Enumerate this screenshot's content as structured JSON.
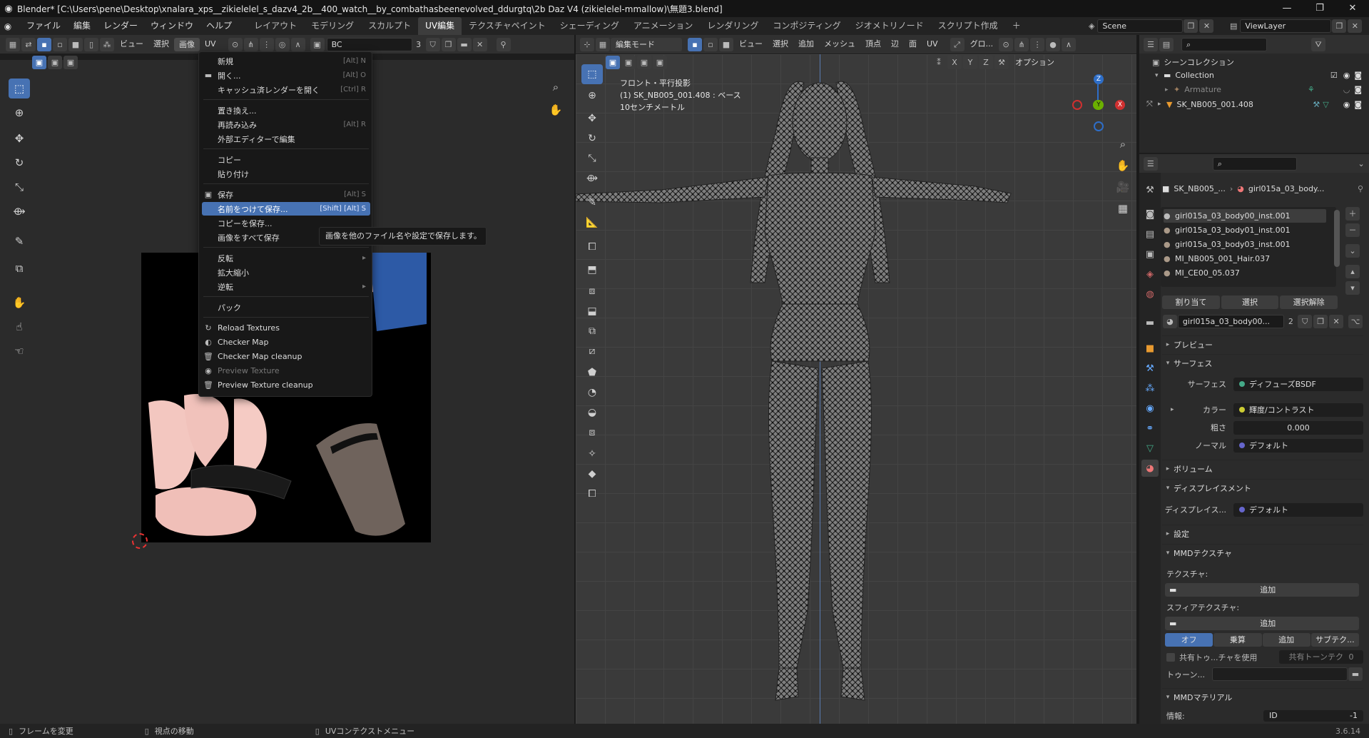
{
  "title": "Blender* [C:\\Users\\pene\\Desktop\\xnalara_xps__zikielelel_s_dazv4_2b__400_watch__by_combathasbeenevolved_ddurgtq\\2b Daz V4 (zikielelel-mmallow)\\無題3.blend]",
  "main_menu": [
    "ファイル",
    "編集",
    "レンダー",
    "ウィンドウ",
    "ヘルプ"
  ],
  "workspaces": [
    "レイアウト",
    "モデリング",
    "スカルプト",
    "UV編集",
    "テクスチャペイント",
    "シェーディング",
    "アニメーション",
    "レンダリング",
    "コンポジティング",
    "ジオメトリノード",
    "スクリプト作成"
  ],
  "active_workspace": "UV編集",
  "scene": "Scene",
  "view_layer": "ViewLayer",
  "uv_header": {
    "view": "ビュー",
    "select": "選択",
    "image": "画像",
    "uv": "UV",
    "image_name": "BC",
    "users": "3"
  },
  "image_menu": {
    "items": [
      {
        "label": "新規",
        "key": "[Alt] N"
      },
      {
        "label": "開く...",
        "key": "[Alt] O"
      },
      {
        "label": "キャッシュ済レンダーを開く",
        "key": "[Ctrl] R"
      },
      {
        "label": "置き換え...",
        "key": ""
      },
      {
        "label": "再読み込み",
        "key": "[Alt] R"
      },
      {
        "label": "外部エディターで編集",
        "key": ""
      },
      {
        "label": "コピー",
        "key": ""
      },
      {
        "label": "貼り付け",
        "key": ""
      },
      {
        "label": "保存",
        "key": "[Alt] S"
      },
      {
        "label": "名前をつけて保存...",
        "key": "[Shift] [Alt] S"
      },
      {
        "label": "コピーを保存...",
        "key": ""
      },
      {
        "label": "画像をすべて保存",
        "key": ""
      },
      {
        "label": "反転",
        "key": ""
      },
      {
        "label": "拡大縮小",
        "key": ""
      },
      {
        "label": "逆転",
        "key": ""
      },
      {
        "label": "パック",
        "key": ""
      },
      {
        "label": "Reload Textures",
        "key": ""
      },
      {
        "label": "Checker Map",
        "key": ""
      },
      {
        "label": "Checker Map cleanup",
        "key": ""
      },
      {
        "label": "Preview Texture",
        "key": ""
      },
      {
        "label": "Preview Texture cleanup",
        "key": ""
      }
    ],
    "tooltip": "画像を他のファイル名や設定で保存します。"
  },
  "viewport_header": {
    "mode": "編集モード",
    "view": "ビュー",
    "select": "選択",
    "add": "追加",
    "mesh": "メッシュ",
    "vertex": "頂点",
    "edge": "辺",
    "face": "面",
    "uv": "UV",
    "orient": "グロ...",
    "options": "オプション",
    "axes": [
      "X",
      "Y",
      "Z"
    ]
  },
  "viewport_info": {
    "line1": "フロント・平行投影",
    "line2": "(1) SK_NB005_001.408 : ベース",
    "line3": "10センチメートル"
  },
  "gizmo": {
    "z": "Z",
    "y": "Y",
    "x": "X"
  },
  "outliner": {
    "root": "シーンコレクション",
    "collection": "Collection",
    "armature": "Armature",
    "mesh": "SK_NB005_001.408"
  },
  "properties": {
    "object": "SK_NB005_...",
    "material": "girl015a_03_body...",
    "slots": [
      "girl015a_03_body00_inst.001",
      "girl015a_03_body01_inst.001",
      "girl015a_03_body03_inst.001",
      "MI_NB005_001_Hair.037",
      "MI_CE00_05.037"
    ],
    "assign": "割り当て",
    "select": "選択",
    "deselect": "選択解除",
    "mat_name": "girl015a_03_body00...",
    "mat_users": "2",
    "preview": "プレビュー",
    "surface_sect": "サーフェス",
    "surface_label": "サーフェス",
    "surface_val": "ディフューズBSDF",
    "color_label": "カラー",
    "color_val": "輝度/コントラスト",
    "rough_label": "粗さ",
    "rough_val": "0.000",
    "normal_label": "ノーマル",
    "normal_val": "デフォルト",
    "volume": "ボリューム",
    "displacement": "ディスプレイスメント",
    "disp_label": "ディスプレイス...",
    "disp_val": "デフォルト",
    "settings": "設定",
    "mmd_tex": "MMDテクスチャ",
    "texture_label": "テクスチャ:",
    "add": "追加",
    "sphere_label": "スフィアテクスチャ:",
    "sphere_opts": [
      "オフ",
      "乗算",
      "追加",
      "サブテク..."
    ],
    "shared_toon": "共有トゥ...チャを使用",
    "shared_toon_val": "共有トーンテク",
    "shared_toon_num": "0",
    "toon_label": "トゥーン...",
    "mmd_mat": "MMDマテリアル",
    "info_label": "情報:",
    "id_label": "ID",
    "id_val": "-1"
  },
  "status": {
    "left": "フレームを変更",
    "mid": "視点の移動",
    "right": "UVコンテクストメニュー",
    "version": "3.6.14"
  },
  "colors": {
    "accent": "#4772b3",
    "header": "#303030",
    "panel": "#2b2b2b"
  }
}
